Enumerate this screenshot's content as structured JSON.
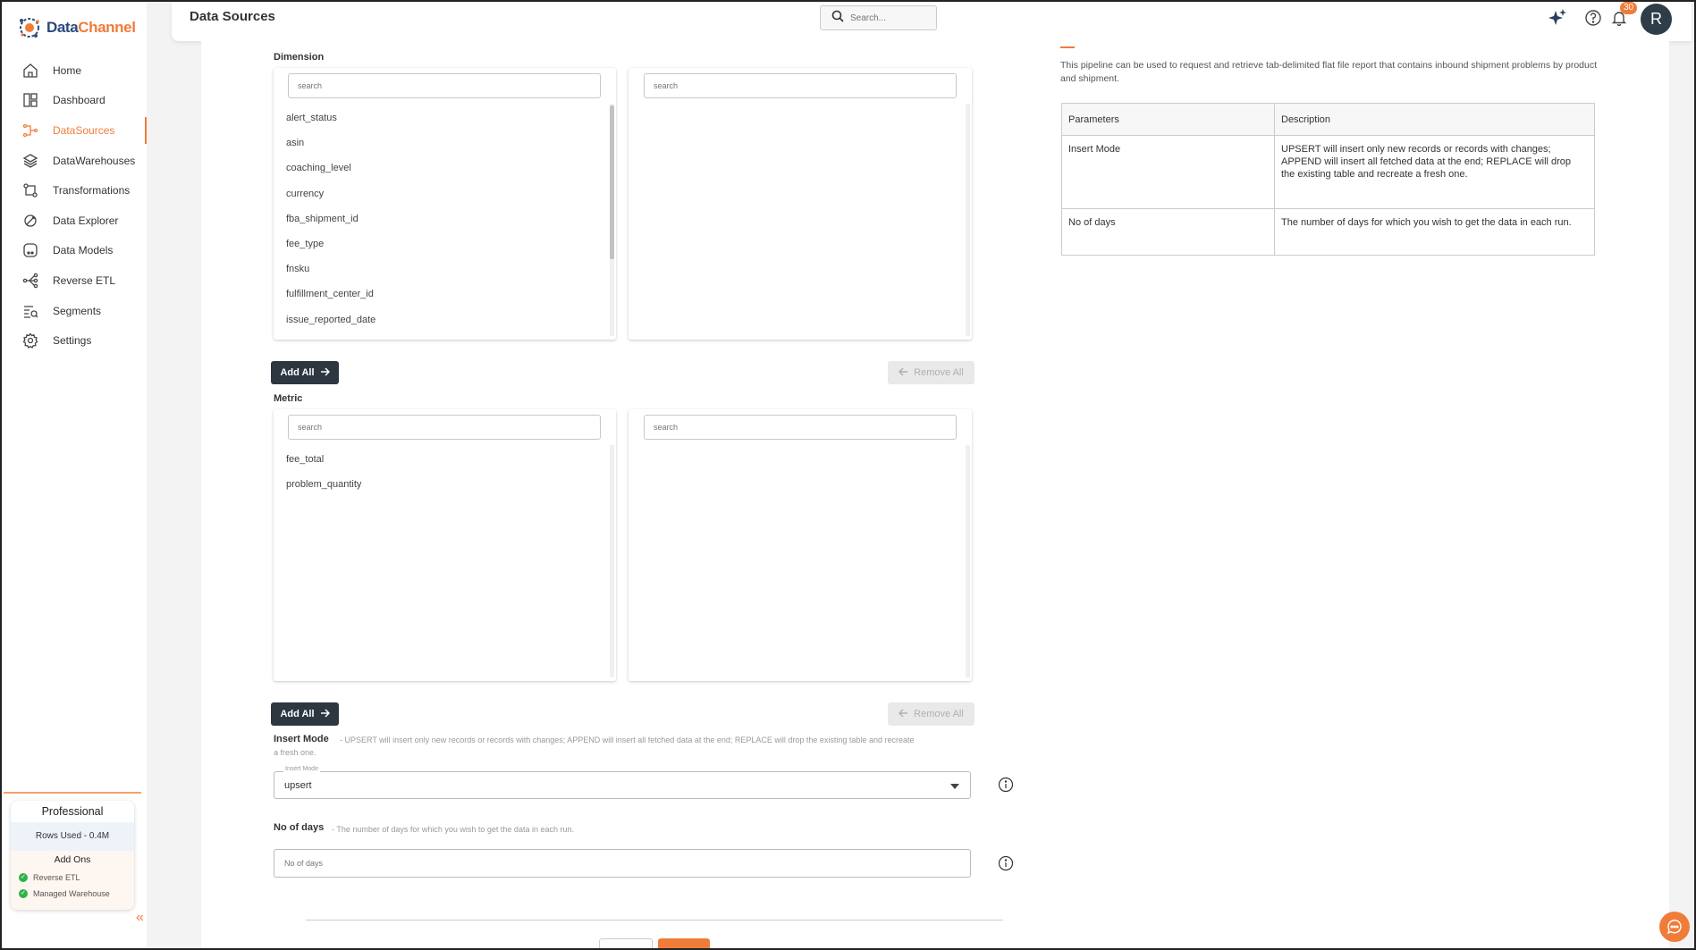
{
  "app": {
    "logo_part1": "Data",
    "logo_part2": "Channel"
  },
  "sidebar": {
    "items": [
      {
        "label": "Home",
        "icon": "home-icon",
        "active": false
      },
      {
        "label": "Dashboard",
        "icon": "dashboard-icon",
        "active": false
      },
      {
        "label": "DataSources",
        "icon": "datasources-icon",
        "active": true
      },
      {
        "label": "DataWarehouses",
        "icon": "layers-icon",
        "active": false
      },
      {
        "label": "Transformations",
        "icon": "transform-icon",
        "active": false
      },
      {
        "label": "Data Explorer",
        "icon": "explorer-icon",
        "active": false
      },
      {
        "label": "Data Models",
        "icon": "models-icon",
        "active": false
      },
      {
        "label": "Reverse ETL",
        "icon": "reverse-etl-icon",
        "active": false
      },
      {
        "label": "Segments",
        "icon": "segments-icon",
        "active": false
      },
      {
        "label": "Settings",
        "icon": "gear-icon",
        "active": false
      }
    ],
    "plan": {
      "title": "Professional",
      "rows_used": "Rows Used - 0.4M",
      "addons_title": "Add Ons",
      "addons": [
        "Reverse ETL",
        "Managed Warehouse"
      ]
    }
  },
  "header": {
    "title": "Data Sources",
    "search_placeholder": "Search...",
    "notification_count": "30",
    "avatar_initial": "R"
  },
  "dimension": {
    "label": "Dimension",
    "left_search_placeholder": "search",
    "right_search_placeholder": "search",
    "items": [
      "alert_status",
      "asin",
      "coaching_level",
      "currency",
      "fba_shipment_id",
      "fee_type",
      "fnsku",
      "fulfillment_center_id",
      "issue_reported_date"
    ],
    "add_all": "Add All",
    "remove_all": "Remove All"
  },
  "metric": {
    "label": "Metric",
    "left_search_placeholder": "search",
    "right_search_placeholder": "search",
    "items": [
      "fee_total",
      "problem_quantity"
    ],
    "add_all": "Add All",
    "remove_all": "Remove All"
  },
  "insert_mode": {
    "title": "Insert Mode",
    "description": "- UPSERT will insert only new records or records with changes; APPEND will insert all fetched data at the end; REPLACE will drop the existing table and recreate a fresh one.",
    "legend": "Insert Mode",
    "value": "upsert"
  },
  "no_of_days": {
    "title": "No of days",
    "description": "- The number of days for which you wish to get the data in each run.",
    "placeholder": "No of days"
  },
  "info_panel": {
    "description": "This pipeline can be used to request and retrieve tab-delimited flat file report that contains inbound shipment problems by product and shipment.",
    "headers": [
      "Parameters",
      "Description"
    ],
    "rows": [
      {
        "param": "Insert Mode",
        "desc": "UPSERT will insert only new records or records with changes; APPEND will insert all fetched data at the end; REPLACE will drop the existing table and recreate a fresh one."
      },
      {
        "param": "No of days",
        "desc": "The number of days for which you wish to get the data in each run."
      }
    ]
  },
  "colors": {
    "accent": "#f07c3a",
    "dark": "#2d3742",
    "brand_blue": "#2a4a7a"
  }
}
